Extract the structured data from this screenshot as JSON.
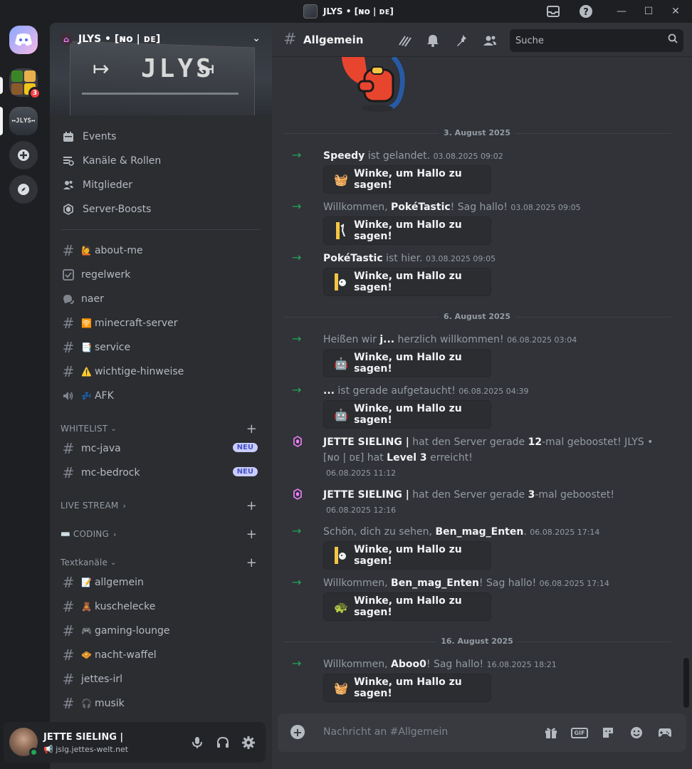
{
  "window": {
    "title": "JLYS • [ɴᴏ | ᴅᴇ]"
  },
  "servers": {
    "badge_count": "3"
  },
  "server": {
    "name": "JLYS • [ɴᴏ | ᴅᴇ]",
    "banner_text": "JLYS",
    "banner_left_arrow": "↦",
    "banner_right_arrow": "↤"
  },
  "nav": {
    "items": [
      {
        "label": "Events",
        "icon": "calendar-icon"
      },
      {
        "label": "Kanäle & Rollen",
        "icon": "channels-roles-icon"
      },
      {
        "label": "Mitglieder",
        "icon": "members-icon"
      },
      {
        "label": "Server-Boosts",
        "icon": "boost-icon"
      }
    ]
  },
  "channels": {
    "about_me": {
      "emoji": "🙋",
      "name": "about-me"
    },
    "regelwerk": {
      "name": "regelwerk"
    },
    "naer": {
      "name": "naer"
    },
    "minecraft": {
      "emoji": "🛜",
      "name": "minecraft-server"
    },
    "service": {
      "emoji": "📑",
      "name": "service"
    },
    "hinweise": {
      "emoji": "⚠️",
      "name": "wichtige-hinweise"
    },
    "afk": {
      "emoji": "💤",
      "name": "AFK"
    },
    "mc_java": {
      "name": "mc-java",
      "badge": "NEU"
    },
    "mc_bedrock": {
      "name": "mc-bedrock",
      "badge": "NEU"
    },
    "allgemein": {
      "emoji": "📝",
      "name": "allgemein"
    },
    "kuschelecke": {
      "emoji": "🧸",
      "name": "kuschelecke"
    },
    "gaming": {
      "emoji": "🎮",
      "name": "gaming-lounge"
    },
    "nacht_waffel": {
      "emoji": "🧇",
      "name": "nacht-waffel"
    },
    "jettes_irl": {
      "name": "jettes-irl"
    },
    "musik": {
      "emoji": "🎧",
      "name": "musik"
    }
  },
  "categories": {
    "whitelist": "WHITELIST",
    "livestream": "LIVE STREAM",
    "coding_emoji": "⌨️",
    "coding": "CODING",
    "textkanaele": "Textkanäle"
  },
  "user": {
    "name": "JETTE SIELING |",
    "status_emoji": "📢",
    "status": "jslg.jettes-welt.net"
  },
  "channel_header": {
    "name": "Allgemein",
    "search_placeholder": "Suche"
  },
  "dates": {
    "d1": "3. August 2025",
    "d2": "6. August 2025",
    "d3": "16. August 2025"
  },
  "messages": {
    "m1": {
      "user": "Speedy",
      "text": " ist gelandet.",
      "ts": "03.08.2025 09:02"
    },
    "m2": {
      "pre": "Willkommen, ",
      "user": "PokéTastic",
      "text": "! Sag hallo!",
      "ts": "03.08.2025 09:05"
    },
    "m3": {
      "user": "PokéTastic",
      "text": " ist hier.",
      "ts": "03.08.2025 09:05"
    },
    "m4": {
      "pre": "Heißen wir ",
      "user": "j...",
      "text": " herzlich willkommen!",
      "ts": "06.08.2025 03:04"
    },
    "m5": {
      "user": "...",
      "text": " ist gerade aufgetaucht!",
      "ts": "06.08.2025 04:39"
    },
    "m6": {
      "user": "JETTE SIELING |",
      "text1": " hat den Server gerade ",
      "count": "12",
      "text2": "-mal geboostet! JLYS • [ɴᴏ | ᴅᴇ] hat ",
      "level": "Level 3",
      "text3": " erreicht!",
      "ts": "06.08.2025 11:12"
    },
    "m7": {
      "user": "JETTE SIELING |",
      "text1": " hat den Server gerade ",
      "count": "3",
      "text2": "-mal geboostet!",
      "ts": "06.08.2025 12:16"
    },
    "m8": {
      "pre": "Schön, dich zu sehen, ",
      "user": "Ben_mag_Enten",
      "text": ".",
      "ts": "06.08.2025 17:14"
    },
    "m9": {
      "pre": "Willkommen, ",
      "user": "Ben_mag_Enten",
      "text": "! Sag hallo!",
      "ts": "06.08.2025 17:14"
    },
    "m10": {
      "pre": "Willkommen, ",
      "user": "Aboo0",
      "text": "! Sag hallo!",
      "ts": "16.08.2025 18:21"
    }
  },
  "wave_button": {
    "label": "Winke, um Hallo zu sagen!"
  },
  "composer": {
    "placeholder": "Nachricht an #Allgemein",
    "gif": "GIF"
  },
  "colors": {
    "accent_green": "#23a55a",
    "boost_pink": "#f47fff",
    "badge_red": "#f23f43",
    "neu_badge": "#c9cdfb"
  }
}
